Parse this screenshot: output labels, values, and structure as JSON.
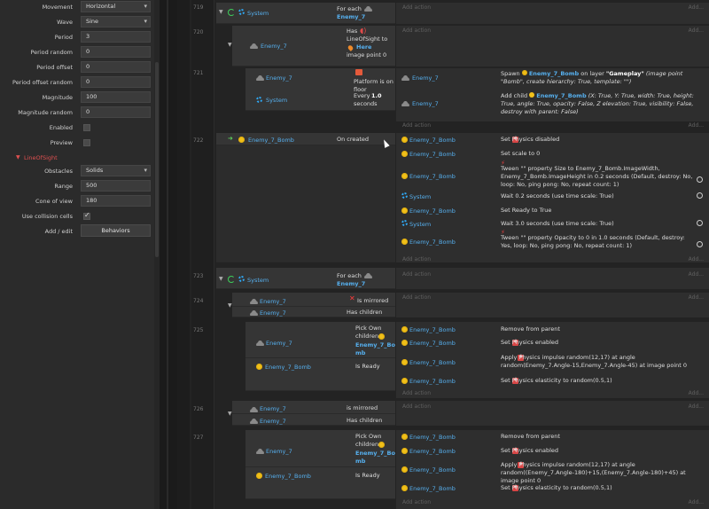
{
  "properties": {
    "rows": [
      {
        "label": "Movement",
        "value": "Horizontal",
        "kind": "select"
      },
      {
        "label": "Wave",
        "value": "Sine",
        "kind": "select"
      },
      {
        "label": "Period",
        "value": "3",
        "kind": "text"
      },
      {
        "label": "Period random",
        "value": "0",
        "kind": "text"
      },
      {
        "label": "Period offset",
        "value": "0",
        "kind": "text"
      },
      {
        "label": "Period offset random",
        "value": "0",
        "kind": "text"
      },
      {
        "label": "Magnitude",
        "value": "100",
        "kind": "text"
      },
      {
        "label": "Magnitude random",
        "value": "0",
        "kind": "text"
      },
      {
        "label": "Enabled",
        "checked": false,
        "kind": "check"
      },
      {
        "label": "Preview",
        "checked": false,
        "kind": "check"
      }
    ],
    "section_title": "LineOfSight",
    "los_rows": [
      {
        "label": "Obstacles",
        "value": "Solids",
        "kind": "select"
      },
      {
        "label": "Range",
        "value": "500",
        "kind": "text"
      },
      {
        "label": "Cone of view",
        "value": "180",
        "kind": "text"
      },
      {
        "label": "Use collision cells",
        "checked": true,
        "kind": "check"
      },
      {
        "label": "Add / edit",
        "value": "Behaviors",
        "kind": "button"
      }
    ]
  },
  "sheet": {
    "add_action": "Add action",
    "add": "Add...",
    "event_numbers": [
      "719",
      "720",
      "721",
      "722",
      "723",
      "724",
      "725",
      "726",
      "727"
    ],
    "e719": {
      "obj": "System",
      "cond": "For each",
      "cond_obj": "Enemy_7"
    },
    "e720": {
      "obj": "Enemy_7",
      "cond_a": "Has",
      "cond_b": "LineOfSight to",
      "cond_here": "Here",
      "cond_c": "image point 0"
    },
    "e721": {
      "c1_obj": "Enemy_7",
      "c1_text": "Platform is on floor",
      "c2_obj": "System",
      "c2_text_a": "Every",
      "c2_num": "1.0",
      "c2_text_b": "seconds",
      "a1_obj": "Enemy_7",
      "a1_text_a": "Spawn",
      "a1_name": "Enemy_7_Bomb",
      "a1_text_b": "on layer",
      "a1_layer": "\"Gameplay\"",
      "a1_text_c": "(image point \"Bomb\", create hierarchy: True, template: \"\")",
      "a2_obj": "Enemy_7",
      "a2_text_a": "Add child",
      "a2_name": "Enemy_7_Bomb",
      "a2_text_b": "(X: True, Y: True, width: True, height: True, angle: True, opacity: False, Z elevation: True, visibility: False, destroy with parent: False)"
    },
    "e722": {
      "obj": "Enemy_7_Bomb",
      "cond": "On created",
      "actions": [
        {
          "obj": "Enemy_7_Bomb",
          "text": "Set  Physics disabled"
        },
        {
          "obj": "Enemy_7_Bomb",
          "text": "Set scale to 0"
        },
        {
          "obj": "Enemy_7_Bomb",
          "text": "Tween \"\" property Size to Enemy_7_Bomb.ImageWidth, Enemy_7_Bomb.ImageHeight in 0.2 seconds (Default, destroy: No, loop: No, ping pong: No, repeat count: 1)"
        },
        {
          "obj": "System",
          "text": "Wait 0.2 seconds (use time scale: True)"
        },
        {
          "obj": "Enemy_7_Bomb",
          "text": "Set Ready to True"
        },
        {
          "obj": "System",
          "text": "Wait 3.0 seconds (use time scale: True)"
        },
        {
          "obj": "Enemy_7_Bomb",
          "text": "Tween \"\" property Opacity to 0 in 1.0 seconds (Default, destroy: Yes, loop: No, ping pong: No, repeat count: 1)"
        }
      ]
    },
    "e723": {
      "obj": "System",
      "cond": "For each",
      "cond_obj": "Enemy_7"
    },
    "e724": {
      "obj1": "Enemy_7",
      "cond1": "Is mirrored",
      "obj2": "Enemy_7",
      "cond2": "Has children"
    },
    "e725": {
      "c1_obj": "Enemy_7",
      "c1_text_a": "Pick Own children",
      "c1_name": "Enemy_7_Bo mb",
      "c2_obj": "Enemy_7_Bomb",
      "c2_text": "Is Ready",
      "actions": [
        {
          "obj": "Enemy_7_Bomb",
          "text": "Remove from parent"
        },
        {
          "obj": "Enemy_7_Bomb",
          "text": "Set  Physics enabled"
        },
        {
          "obj": "Enemy_7_Bomb",
          "text": "Apply  Physics impulse random(12,17) at angle random(Enemy_7.Angle-15,Enemy_7.Angle-45) at image point 0"
        },
        {
          "obj": "Enemy_7_Bomb",
          "text": "Set  Physics elasticity to random(0.5,1)"
        }
      ]
    },
    "e726": {
      "obj1": "Enemy_7",
      "cond1": "is mirrored",
      "obj2": "Enemy_7",
      "cond2": "Has children"
    },
    "e727": {
      "c1_obj": "Enemy_7",
      "c1_text_a": "Pick Own children",
      "c1_name": "Enemy_7_Bo mb",
      "c2_obj": "Enemy_7_Bomb",
      "c2_text": "Is Ready",
      "actions": [
        {
          "obj": "Enemy_7_Bomb",
          "text": "Remove from parent"
        },
        {
          "obj": "Enemy_7_Bomb",
          "text": "Set  Physics enabled"
        },
        {
          "obj": "Enemy_7_Bomb",
          "text": "Apply  Physics impulse random(12,17) at angle random((Enemy_7.Angle-180)+15,(Enemy_7.Angle-180)+45) at image point 0"
        },
        {
          "obj": "Enemy_7_Bomb",
          "text": "Set  Physics elasticity to random(0.5,1)"
        }
      ]
    }
  }
}
